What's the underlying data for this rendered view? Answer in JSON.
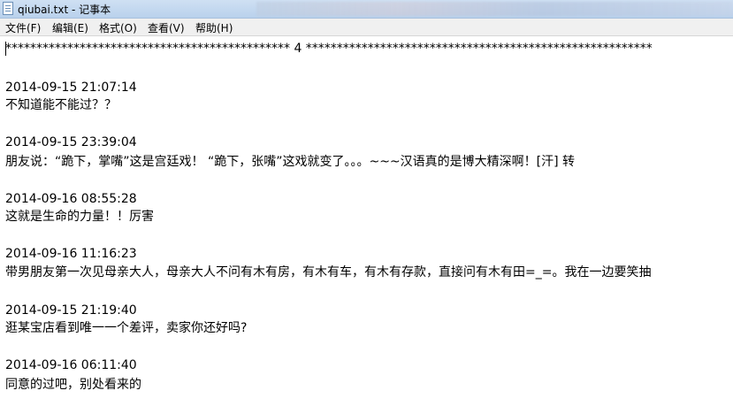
{
  "window": {
    "title": "qiubai.txt - 记事本",
    "icon": "notepad-icon"
  },
  "menu": {
    "items": [
      {
        "label": "文件(F)"
      },
      {
        "label": "编辑(E)"
      },
      {
        "label": "格式(O)"
      },
      {
        "label": "查看(V)"
      },
      {
        "label": "帮助(H)"
      }
    ]
  },
  "editor": {
    "separator": "**********************************************  4  ********************************************************",
    "entries": [
      {
        "timestamp": "2014-09-15 21:07:14",
        "text": "不知道能不能过？？"
      },
      {
        "timestamp": "2014-09-15 23:39:04",
        "text": "朋友说：“跪下，掌嘴”这是宫廷戏！ “跪下，张嘴”这戏就变了。。。~~~汉语真的是博大精深啊！[汗] 转"
      },
      {
        "timestamp": "2014-09-16 08:55:28",
        "text": "这就是生命的力量！！厉害"
      },
      {
        "timestamp": "2014-09-16 11:16:23",
        "text": "带男朋友第一次见母亲大人，母亲大人不问有木有房，有木有车，有木有存款，直接问有木有田=_=。我在一边要笑抽"
      },
      {
        "timestamp": "2014-09-15 21:19:40",
        "text": "逛某宝店看到唯一一个差评，卖家你还好吗?"
      },
      {
        "timestamp": "2014-09-16 06:11:40",
        "text": "同意的过吧，别处看来的"
      }
    ]
  }
}
